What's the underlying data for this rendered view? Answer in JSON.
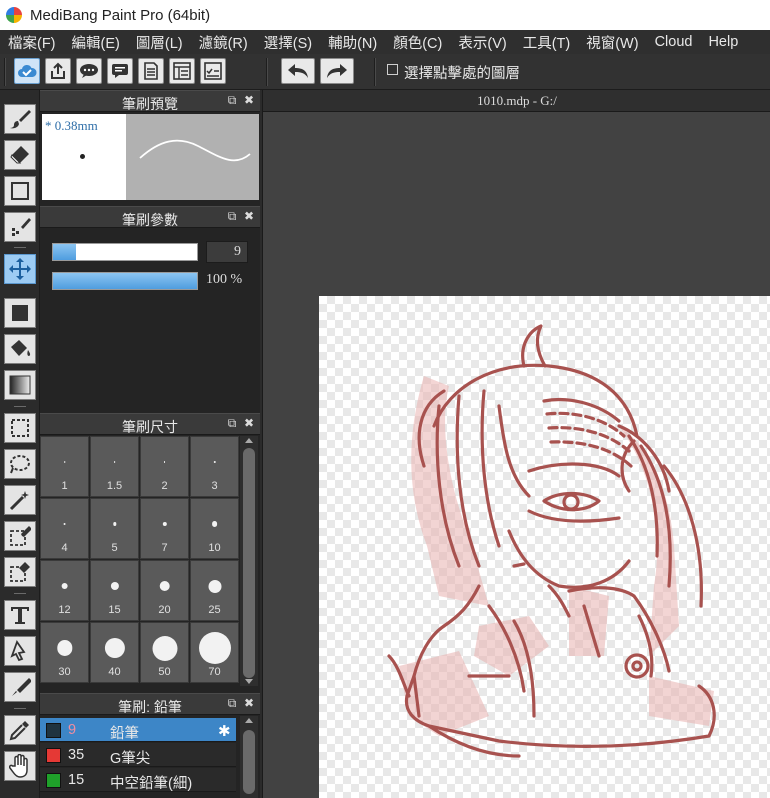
{
  "window": {
    "title": "MediBang Paint Pro (64bit)"
  },
  "menu": {
    "items": [
      "檔案(F)",
      "編輯(E)",
      "圖層(L)",
      "濾鏡(R)",
      "選擇(S)",
      "輔助(N)",
      "顏色(C)",
      "表示(V)",
      "工具(T)",
      "視窗(W)",
      "Cloud",
      "Help"
    ]
  },
  "toolbar": {
    "select_clicked_layer_label": "選擇點擊處的圖層",
    "select_clicked_layer_checked": false
  },
  "panels": {
    "brush_preview": {
      "title": "筆刷預覽",
      "size_label": "* 0.38mm"
    },
    "brush_params": {
      "title": "筆刷參數",
      "size_value": "9",
      "size_fill_fraction": 0.16,
      "opacity_label": "100 %",
      "opacity_fraction": 1.0
    },
    "brush_size": {
      "title": "筆刷尺寸",
      "sizes": [
        "1",
        "1.5",
        "2",
        "3",
        "4",
        "5",
        "7",
        "10",
        "12",
        "15",
        "20",
        "25",
        "30",
        "40",
        "50",
        "70"
      ]
    },
    "brush_list": {
      "title": "筆刷: 鉛筆",
      "items": [
        {
          "size": "9",
          "name": "鉛筆",
          "color": "#1f3340",
          "selected": true
        },
        {
          "size": "35",
          "name": "G筆尖",
          "color": "#e53935",
          "selected": false
        },
        {
          "size": "15",
          "name": "中空鉛筆(細)",
          "color": "#1fa12a",
          "selected": false
        }
      ]
    }
  },
  "document": {
    "tab_title": "1010.mdp - G:/"
  },
  "colors": {
    "sketch_stroke": "#a8524f",
    "sketch_shadow": "#e9b2b0",
    "accent": "#3d86c7"
  }
}
